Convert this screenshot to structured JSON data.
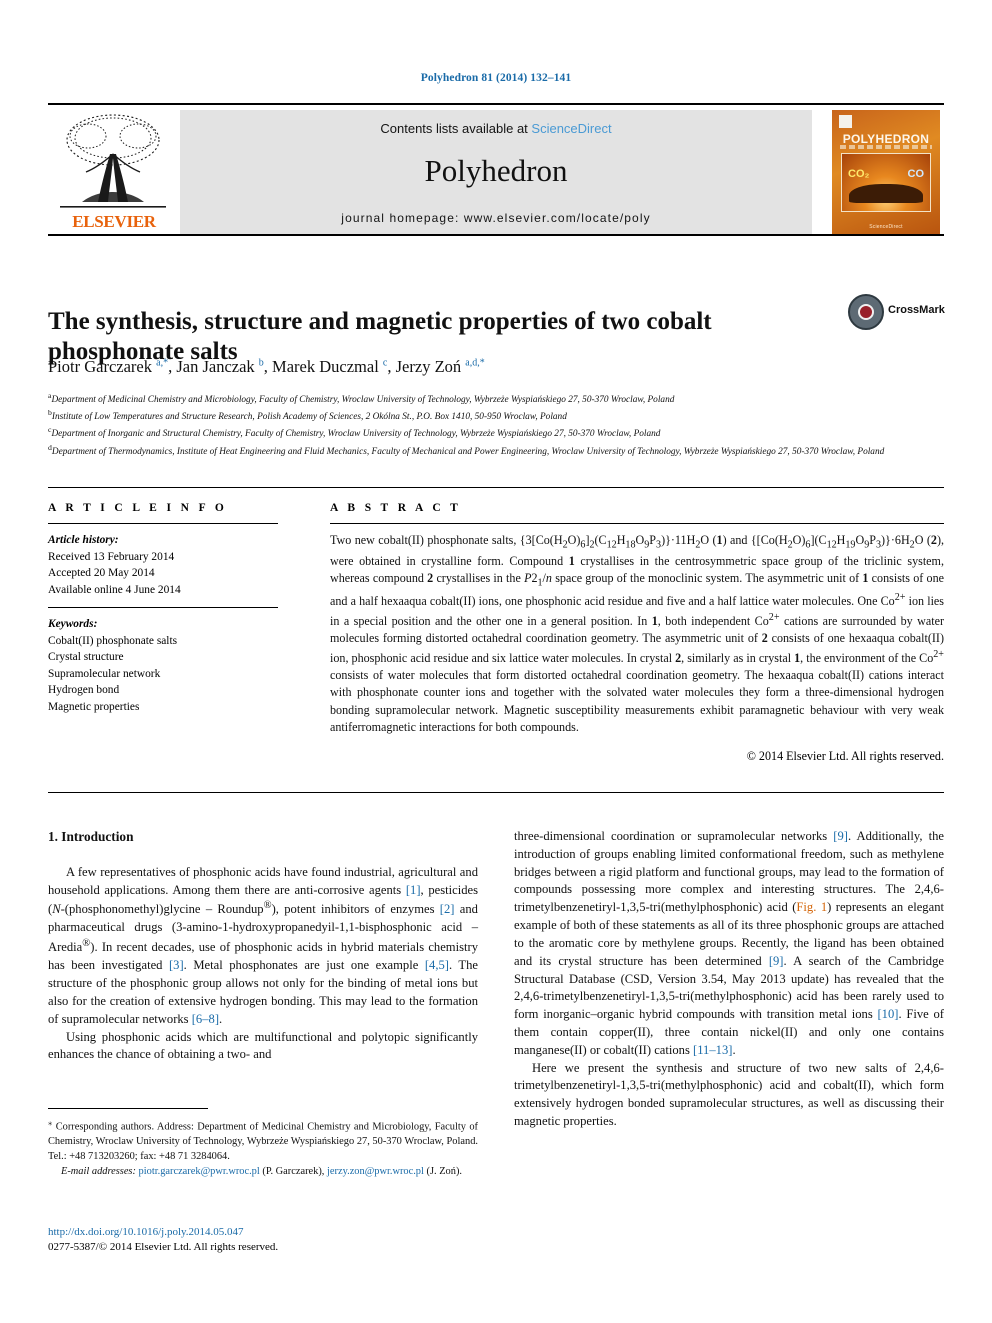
{
  "running_head": "Polyhedron 81 (2014) 132–141",
  "masthead": {
    "contents_prefix": "Contents lists available at ",
    "sciencedirect": "ScienceDirect",
    "journal_name": "Polyhedron",
    "homepage": "journal homepage: www.elsevier.com/locate/poly",
    "publisher_wordmark": "ELSEVIER",
    "cover": {
      "title": "POLYHEDRON",
      "label_left": "CO₂",
      "label_right": "CO",
      "footer": "ScienceDirect"
    }
  },
  "article": {
    "title": "The synthesis, structure and magnetic properties of two cobalt phosphonate salts",
    "crossmark_label": "CrossMark",
    "authors_html": "Piotr Garczarek <sup>a,</sup><sup>*</sup>, Jan Janczak <sup>b</sup>, Marek Duczmal <sup>c</sup>, Jerzy Zoń <sup>a,d,</sup><sup>*</sup>",
    "affiliations": [
      "Department of Medicinal Chemistry and Microbiology, Faculty of Chemistry, Wroclaw University of Technology, Wybrzeże Wyspiańskiego 27, 50-370 Wroclaw, Poland",
      "Institute of Low Temperatures and Structure Research, Polish Academy of Sciences, 2 Okólna St., P.O. Box 1410, 50-950 Wroclaw, Poland",
      "Department of Inorganic and Structural Chemistry, Faculty of Chemistry, Wroclaw University of Technology, Wybrzeże Wyspiańskiego 27, 50-370 Wroclaw, Poland",
      "Department of Thermodynamics, Institute of Heat Engineering and Fluid Mechanics, Faculty of Mechanical and Power Engineering, Wroclaw University of Technology, Wybrzeże Wyspiańskiego 27, 50-370 Wroclaw, Poland"
    ],
    "affiliation_markers": [
      "a",
      "b",
      "c",
      "d"
    ]
  },
  "article_info": {
    "heading": "A R T I C L E  I N F O",
    "history_label": "Article history:",
    "history": [
      "Received 13 February 2014",
      "Accepted 20 May 2014",
      "Available online 4 June 2014"
    ],
    "keywords_label": "Keywords:",
    "keywords": [
      "Cobalt(II) phosphonate salts",
      "Crystal structure",
      "Supramolecular network",
      "Hydrogen bond",
      "Magnetic properties"
    ]
  },
  "abstract": {
    "heading": "A B S T R A C T",
    "body_html": "Two new cobalt(II) phosphonate salts, {3[Co(H<sub>2</sub>O)<sub>6</sub>]<sub>2</sub>(C<sub>12</sub>H<sub>18</sub>O<sub>9</sub>P<sub>3</sub>)}·11H<sub>2</sub>O (<b>1</b>) and {[Co(H<sub>2</sub>O)<sub>6</sub>](C<sub>12</sub>H<sub>19</sub>O<sub>9</sub>P<sub>3</sub>)}·6H<sub>2</sub>O (<b>2</b>), were obtained in crystalline form. Compound <b>1</b> crystallises in the centrosymmetric space group of the triclinic system, whereas compound <b>2</b> crystallises in the <i>P</i>2<sub>1</sub>/<i>n</i> space group of the monoclinic system. The asymmetric unit of <b>1</b> consists of one and a half hexaaqua cobalt(II) ions, one phosphonic acid residue and five and a half lattice water molecules. One Co<sup>2+</sup> ion lies in a special position and the other one in a general position. In <b>1</b>, both independent Co<sup>2+</sup> cations are surrounded by water molecules forming distorted octahedral coordination geometry. The asymmetric unit of <b>2</b> consists of one hexaaqua cobalt(II) ion, phosphonic acid residue and six lattice water molecules. In crystal <b>2</b>, similarly as in crystal <b>1</b>, the environment of the Co<sup>2+</sup> consists of water molecules that form distorted octahedral coordination geometry. The hexaaqua cobalt(II) cations interact with phosphonate counter ions and together with the solvated water molecules they form a three-dimensional hydrogen bonding supramolecular network. Magnetic susceptibility measurements exhibit paramagnetic behaviour with very weak antiferromagnetic interactions for both compounds.",
    "copyright": "© 2014 Elsevier Ltd. All rights reserved."
  },
  "body": {
    "section_heading": "1. Introduction",
    "left_paragraphs_html": [
      "A few representatives of phosphonic acids have found industrial, agricultural and household applications. Among them there are anti-corrosive agents <span class=\"ref\">[1]</span>, pesticides (<i>N</i>-(phosphonomethyl)glycine – Roundup<sup>®</sup>), potent inhibitors of enzymes <span class=\"ref\">[2]</span> and pharmaceutical drugs (3-amino-1-hydroxypropanedyil-1,1-bisphosphonic acid – Aredia<sup>®</sup>). In recent decades, use of phosphonic acids in hybrid materials chemistry has been investigated <span class=\"ref\">[3]</span>. Metal phosphonates are just one example <span class=\"ref\">[4,5]</span>. The structure of the phosphonic group allows not only for the binding of metal ions but also for the creation of extensive hydrogen bonding. This may lead to the formation of supramolecular networks <span class=\"ref\">[6–8]</span>.",
      "Using phosphonic acids which are multifunctional and polytopic significantly enhances the chance of obtaining a two- and"
    ],
    "right_paragraphs_html": [
      "three-dimensional coordination or supramolecular networks <span class=\"ref\">[9]</span>. Additionally, the introduction of groups enabling limited conformational freedom, such as methylene bridges between a rigid platform and functional groups, may lead to the formation of compounds possessing more complex and interesting structures. The 2,4,6-trimetylbenzenetiryl-1,3,5-tri(methylphosphonic) acid (<span class=\"figref\">Fig. 1</span>) represents an elegant example of both of these statements as all of its three phosphonic groups are attached to the aromatic core by methylene groups. Recently, the ligand has been obtained and its crystal structure has been determined <span class=\"ref\">[9]</span>. A search of the Cambridge Structural Database (CSD, Version 3.54, May 2013 update) has revealed that the 2,4,6-trimetylbenzenetiryl-1,3,5-tri(methylphosphonic) acid has been rarely used to form inorganic–organic hybrid compounds with transition metal ions <span class=\"ref\">[10]</span>. Five of them contain copper(II), three contain nickel(II) and only one contains manganese(II) or cobalt(II) cations <span class=\"ref\">[11–13]</span>.",
      "Here we present the synthesis and structure of two new salts of 2,4,6-trimetylbenzenetiryl-1,3,5-tri(methylphosphonic) acid and cobalt(II), which form extensively hydrogen bonded supramolecular structures, as well as discussing their magnetic properties."
    ]
  },
  "footnotes": {
    "corresponding_html": "<sup>⁎</sup> Corresponding authors. Address: Department of Medicinal Chemistry and Microbiology, Faculty of Chemistry, Wroclaw University of Technology, Wybrzeże Wyspiańskiego 27, 50-370 Wroclaw, Poland. Tel.: +48 713203260; fax: +48 71 3284064.",
    "email_html": "<span class=\"lead\">E-mail addresses:</span> <span class=\"link\">piotr.garczarek@pwr.wroc.pl</span> (P. Garczarek), <span class=\"link\">jerzy.zon@pwr.wroc.pl</span> (J. Zoń)."
  },
  "footer": {
    "doi": "http://dx.doi.org/10.1016/j.poly.2014.05.047",
    "issn_line": "0277-5387/© 2014 Elsevier Ltd. All rights reserved."
  }
}
